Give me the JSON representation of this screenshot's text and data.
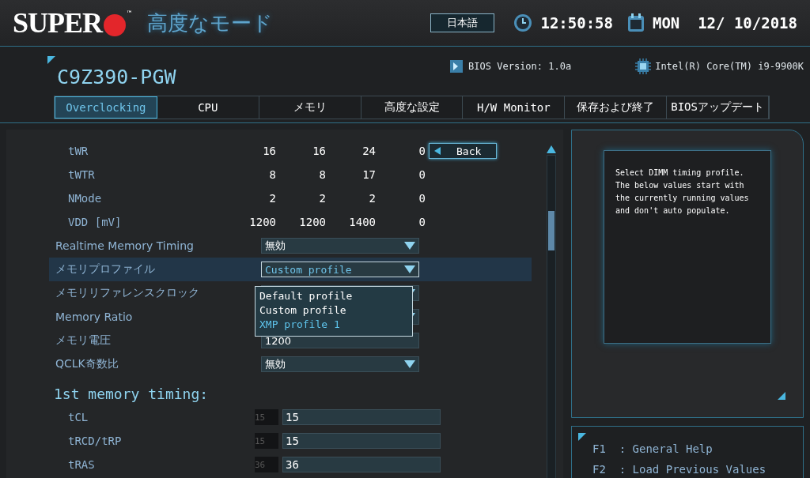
{
  "header": {
    "logo": "SUPER",
    "trademark": "™",
    "mode_title": "高度なモード",
    "language": "日本語",
    "time": "12:50:58",
    "date": "MON  12/ 10/2018"
  },
  "board": {
    "model": "C9Z390-PGW",
    "bios_version": "BIOS Version: 1.0a",
    "cpu": "Intel(R) Core(TM) i9-9900K"
  },
  "tabs": [
    {
      "label": "Overclocking",
      "selected": true
    },
    {
      "label": "CPU",
      "selected": false
    },
    {
      "label": "メモリ",
      "selected": false
    },
    {
      "label": "高度な設定",
      "selected": false
    },
    {
      "label": "H/W Monitor",
      "selected": false
    },
    {
      "label": "保存および終了",
      "selected": false
    },
    {
      "label": "BIOSアップデート",
      "selected": false
    }
  ],
  "timing_table": [
    {
      "label": "tWR",
      "values": [
        "16",
        "16",
        "24",
        "0"
      ]
    },
    {
      "label": "tWTR",
      "values": [
        "8",
        "8",
        "17",
        "0"
      ]
    },
    {
      "label": "NMode",
      "values": [
        "2",
        "2",
        "2",
        "0"
      ]
    },
    {
      "label": "VDD [mV]",
      "values": [
        "1200",
        "1200",
        "1400",
        "0"
      ]
    }
  ],
  "back_button": "Back",
  "settings": [
    {
      "kind": "dropdown",
      "label": "Realtime Memory Timing",
      "value": "無効",
      "selected": false
    },
    {
      "kind": "dropdown",
      "label": "メモリプロファイル",
      "value": "Custom profile",
      "selected": true,
      "expanded": true,
      "options": [
        {
          "label": "Default profile",
          "highlighted": false
        },
        {
          "label": "Custom profile",
          "highlighted": false
        },
        {
          "label": "XMP profile 1",
          "highlighted": true
        }
      ]
    },
    {
      "kind": "dropdown",
      "label": "メモリリファレンスクロック",
      "selected": false
    },
    {
      "kind": "dropdown",
      "label": "Memory Ratio",
      "selected": false
    },
    {
      "kind": "number",
      "label": "メモリ電圧",
      "value": "1200",
      "selected": false
    },
    {
      "kind": "dropdown",
      "label": "QCLK奇数比",
      "value": "無効",
      "selected": false
    }
  ],
  "section_title": "1st memory timing:",
  "timing_inputs": [
    {
      "label": "tCL",
      "current": "15",
      "value": "15"
    },
    {
      "label": "tRCD/tRP",
      "current": "15",
      "value": "15"
    },
    {
      "label": "tRAS",
      "current": "36",
      "value": "36"
    }
  ],
  "help_text": "Select DIMM timing profile. The below values start with the currently running values and don't auto populate.",
  "keys": [
    {
      "key": "F1",
      "description": ": General Help"
    },
    {
      "key": "F2",
      "description": ": Load Previous Values"
    }
  ]
}
